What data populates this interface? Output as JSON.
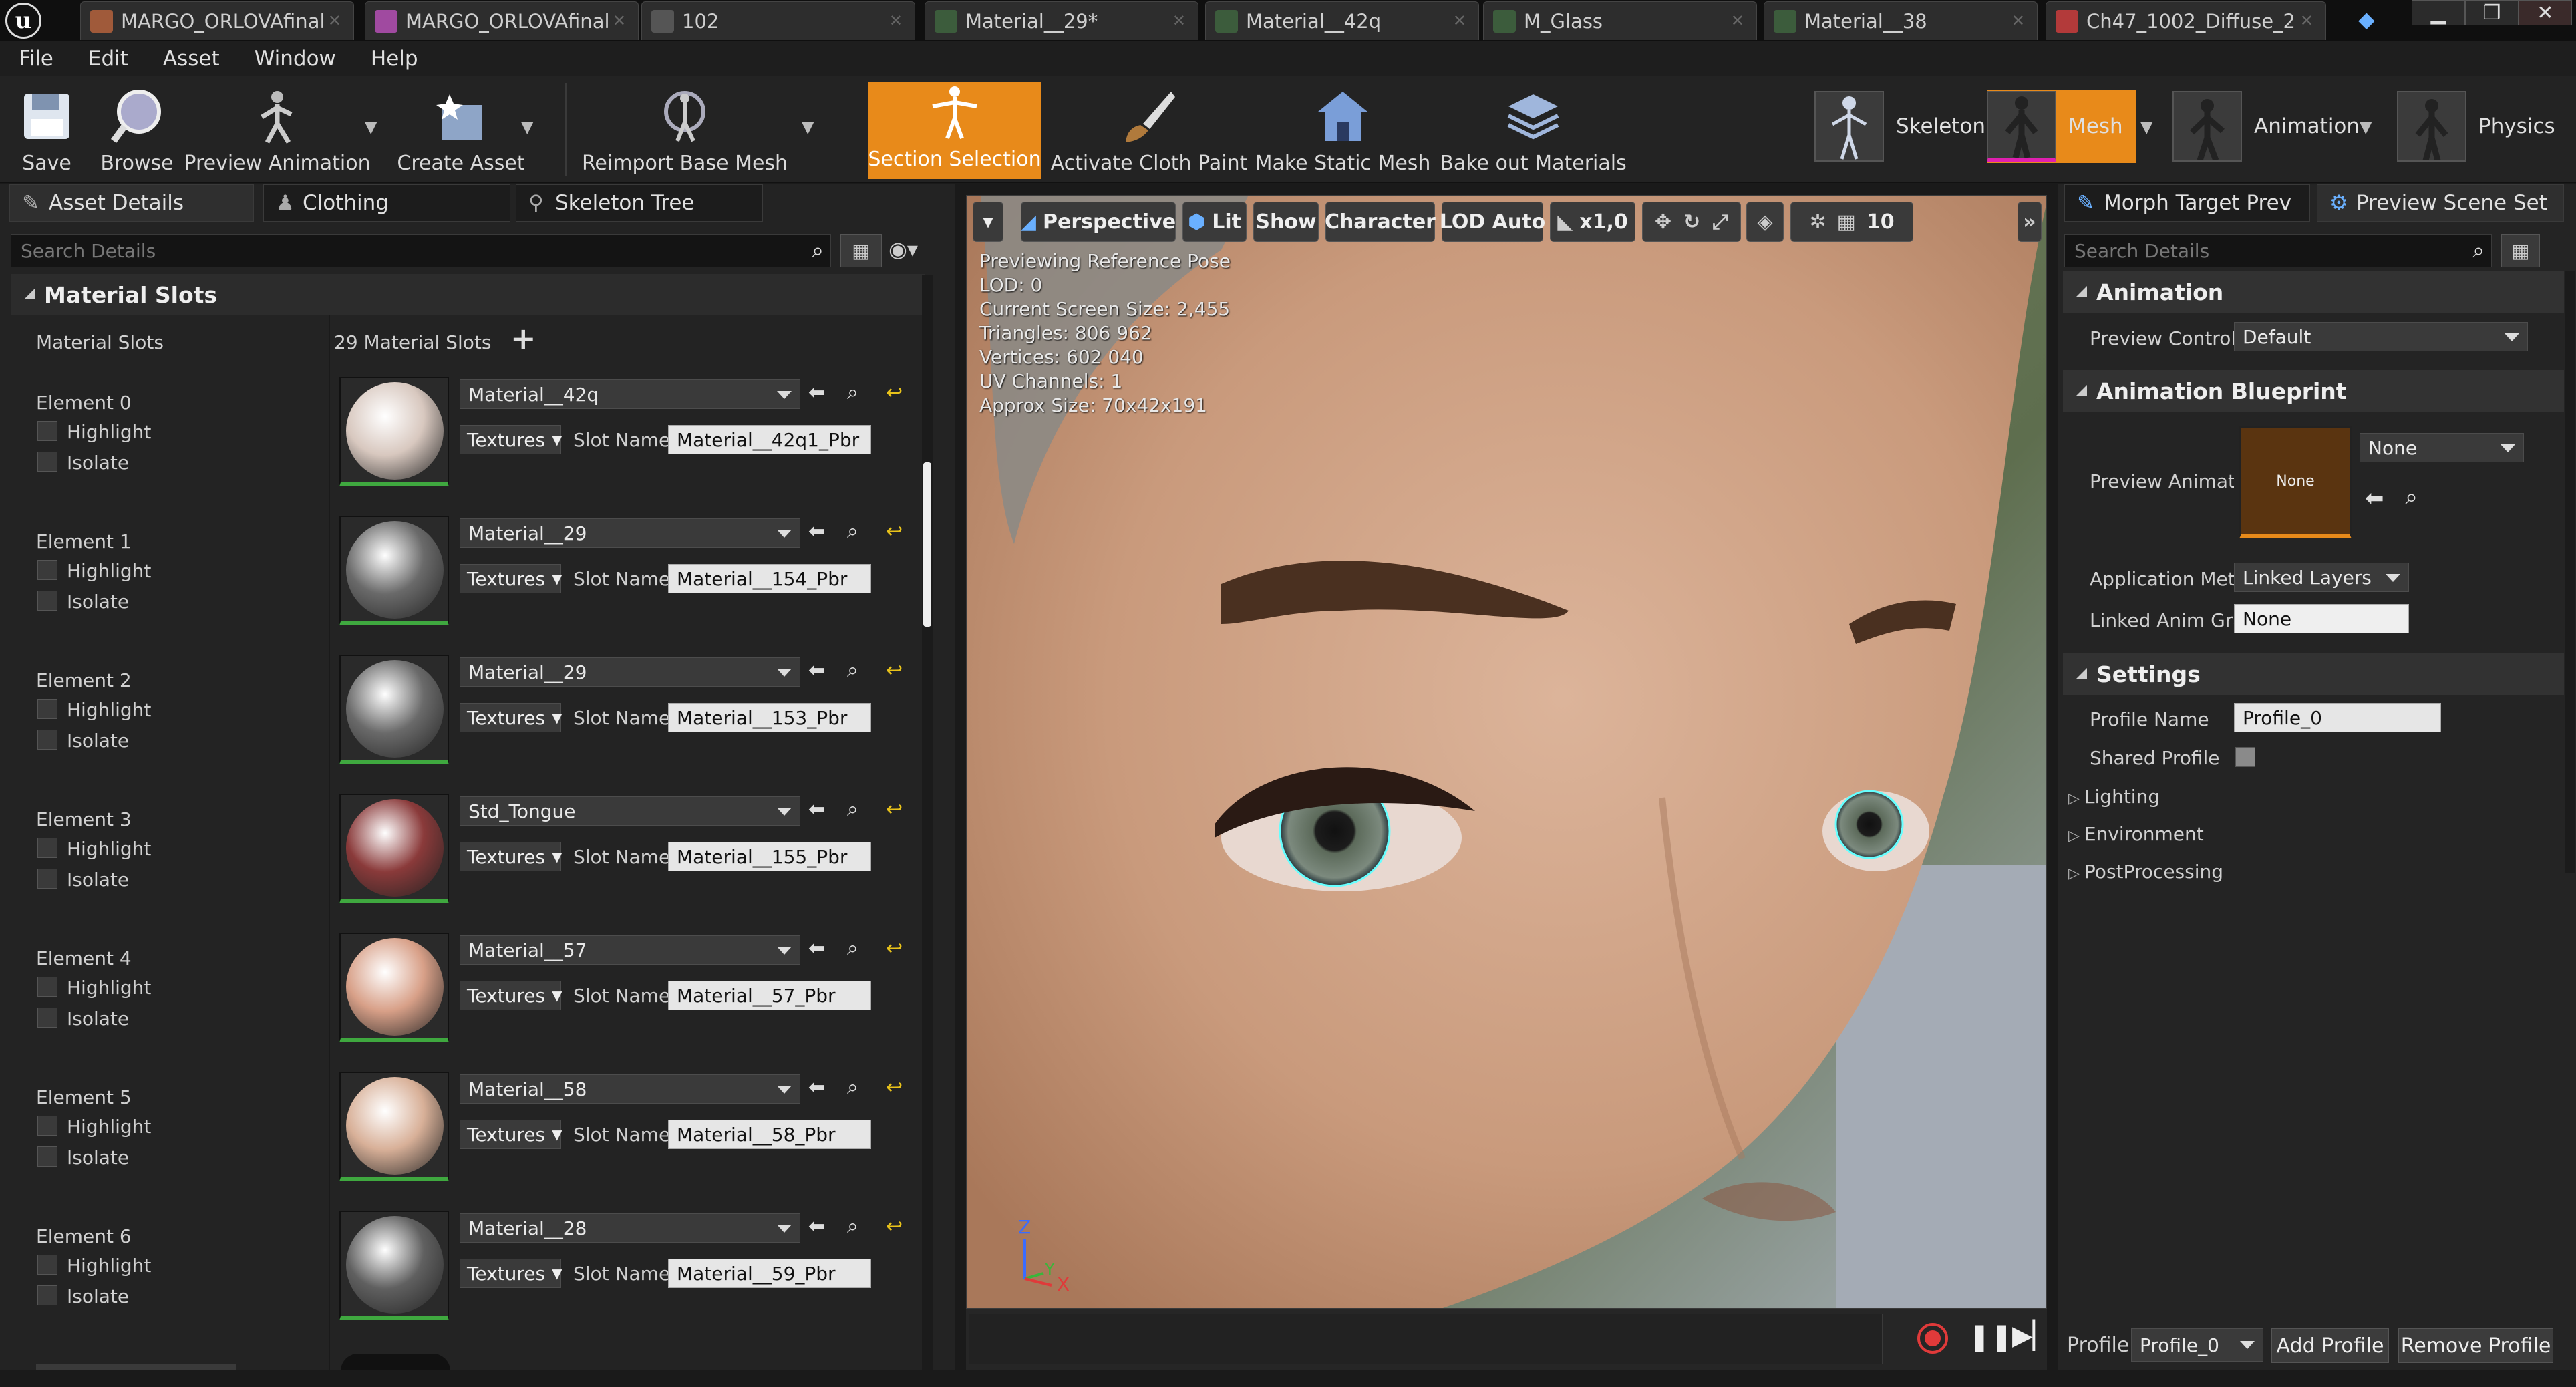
{
  "doc_tabs": [
    {
      "label": "MARGO_ORLOVAfinal",
      "icon": "skeleton-asset-icon",
      "color": "#a05a3a"
    },
    {
      "label": "MARGO_ORLOVAfinal",
      "icon": "mesh-asset-icon",
      "color": "#a04aa0"
    },
    {
      "label": "102",
      "icon": "anim-asset-icon",
      "color": "#555555"
    },
    {
      "label": "Material__29*",
      "icon": "material-icon",
      "color": "#3c5c3c"
    },
    {
      "label": "Material__42q",
      "icon": "material-icon",
      "color": "#3c5c3c"
    },
    {
      "label": "M_Glass",
      "icon": "material-icon",
      "color": "#3c5c3c"
    },
    {
      "label": "Material__38",
      "icon": "material-icon",
      "color": "#3c5c3c"
    },
    {
      "label": "Ch47_1002_Diffuse_2",
      "icon": "texture-icon",
      "color": "#b33a3a"
    }
  ],
  "window_buttons": {
    "minimize": "▁",
    "maximize": "❐",
    "close": "✕"
  },
  "menu": [
    "File",
    "Edit",
    "Asset",
    "Window",
    "Help"
  ],
  "toolbar": {
    "save": "Save",
    "browse": "Browse",
    "preview_animation": "Preview Animation",
    "create_asset": "Create Asset",
    "reimport_base_mesh": "Reimport Base Mesh",
    "section_selection": "Section Selection",
    "activate_cloth_paint": "Activate Cloth Paint",
    "make_static_mesh": "Make Static Mesh",
    "bake_out_materials": "Bake out Materials"
  },
  "modes": {
    "skeleton": "Skeleton",
    "mesh": "Mesh",
    "animation": "Animation",
    "physics": "Physics"
  },
  "left_panel": {
    "tabs": [
      "Asset Details",
      "Clothing",
      "Skeleton Tree"
    ],
    "search_placeholder": "Search Details",
    "section_title": "Material Slots",
    "slots_label": "Material Slots",
    "slots_count": "29 Material Slots",
    "highlight_label": "Highlight",
    "isolate_label": "Isolate",
    "textures_label": "Textures",
    "slot_name_label": "Slot Name",
    "elements": [
      {
        "name": "Element 0",
        "material": "Material__42q",
        "slot_name": "Material__42q1_Pbr",
        "thumb": "#d8c8bf"
      },
      {
        "name": "Element 1",
        "material": "Material__29",
        "slot_name": "Material__154_Pbr",
        "thumb": "#6a6a6a"
      },
      {
        "name": "Element 2",
        "material": "Material__29",
        "slot_name": "Material__153_Pbr",
        "thumb": "#6a6a6a"
      },
      {
        "name": "Element 3",
        "material": "Std_Tongue",
        "slot_name": "Material__155_Pbr",
        "thumb": "#8a3a3a"
      },
      {
        "name": "Element 4",
        "material": "Material__57",
        "slot_name": "Material__57_Pbr",
        "thumb": "#d8a088"
      },
      {
        "name": "Element 5",
        "material": "Material__58",
        "slot_name": "Material__58_Pbr",
        "thumb": "#d8b098"
      },
      {
        "name": "Element 6",
        "material": "Material__28",
        "slot_name": "Material__59_Pbr",
        "thumb": "#606060"
      }
    ]
  },
  "viewport": {
    "view_mode": "Perspective",
    "lighting": "Lit",
    "show": "Show",
    "character": "Character",
    "lod": "LOD Auto",
    "speed": "x1,0",
    "grid_value": "10",
    "stats": [
      "Previewing Reference Pose",
      "LOD: 0",
      "Current Screen Size: 2,455",
      "Triangles: 806 962",
      "Vertices: 602 040",
      "UV Channels: 1",
      "Approx Size: 70x42x191"
    ],
    "axis": {
      "z": "Z",
      "y": "Y",
      "x": "X"
    }
  },
  "right_panel": {
    "tabs": [
      "Morph Target Prev",
      "Preview Scene Set"
    ],
    "search_placeholder": "Search Details",
    "animation_section": "Animation",
    "preview_controller_label": "Preview Controll",
    "preview_controller_value": "Default",
    "blueprint_section": "Animation Blueprint",
    "preview_anim_label": "Preview Animatic",
    "preview_anim_thumb": "None",
    "preview_anim_value": "None",
    "application_method_label": "Application Meth",
    "application_method_value": "Linked Layers",
    "linked_anim_label": "Linked Anim Grap",
    "linked_anim_value": "None",
    "settings_section": "Settings",
    "profile_name_label": "Profile Name",
    "profile_name_value": "Profile_0",
    "shared_profile_label": "Shared Profile",
    "lighting": "Lighting",
    "environment": "Environment",
    "postprocessing": "PostProcessing",
    "footer_profile_label": "Profile",
    "footer_profile_value": "Profile_0",
    "add_profile": "Add Profile",
    "remove_profile": "Remove Profile"
  },
  "colors": {
    "accent_orange": "#e88a1a",
    "mesh_mode_pink": "#e020b0",
    "slot_green": "#3fa83f"
  }
}
